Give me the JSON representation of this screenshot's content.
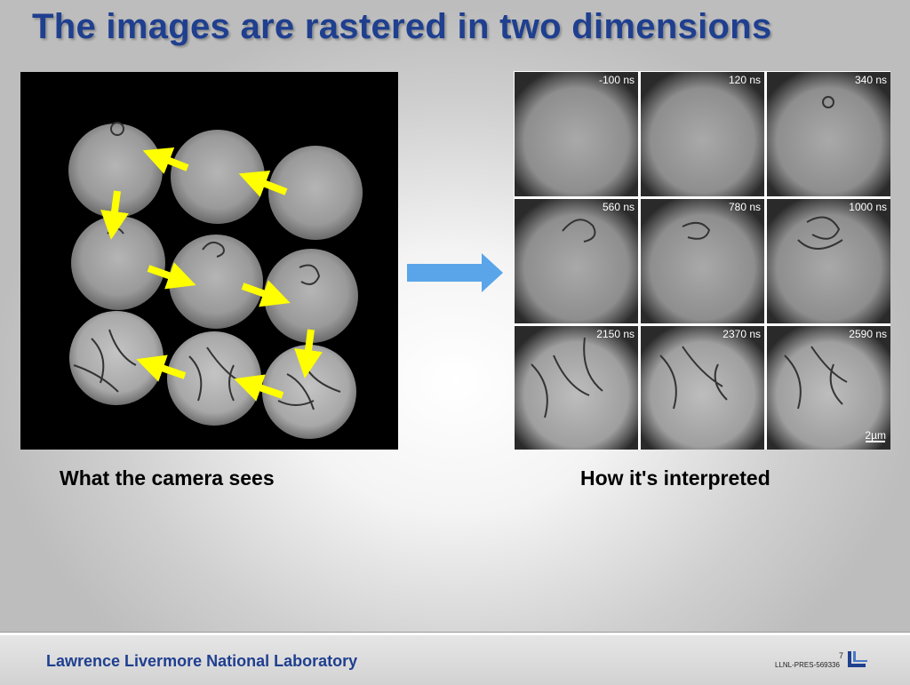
{
  "slide": {
    "title": "The images are rastered in two dimensions",
    "left_caption": "What the camera sees",
    "right_caption": "How it's interpreted"
  },
  "frames": {
    "labels": [
      "-100 ns",
      "120 ns",
      "340 ns",
      "560 ns",
      "780 ns",
      "1000 ns",
      "2150 ns",
      "2370 ns",
      "2590 ns"
    ],
    "scale_bar": "2µm"
  },
  "footer": {
    "lab_name": "Lawrence Livermore National Laboratory",
    "doc_id": "LLNL-PRES-569336",
    "page_number": "7"
  },
  "colors": {
    "title": "#1f3f8f",
    "arrow_yellow": "#ffff00",
    "arrow_blue": "#5aa5ea"
  }
}
